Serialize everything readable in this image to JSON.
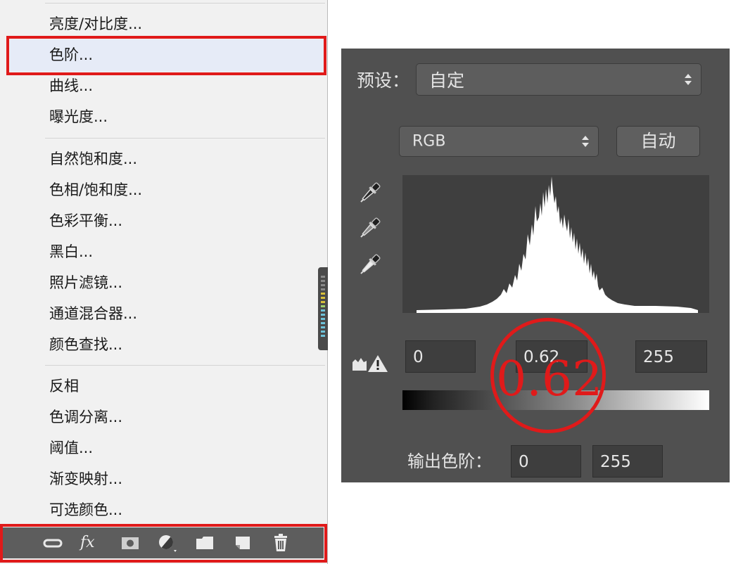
{
  "menu": {
    "items": [
      {
        "label": "亮度/对比度..."
      },
      {
        "label": "色阶..."
      },
      {
        "label": "曲线..."
      },
      {
        "label": "曝光度..."
      },
      {
        "label": "自然饱和度..."
      },
      {
        "label": "色相/饱和度..."
      },
      {
        "label": "色彩平衡..."
      },
      {
        "label": "黑白..."
      },
      {
        "label": "照片滤镜..."
      },
      {
        "label": "通道混合器..."
      },
      {
        "label": "颜色查找..."
      },
      {
        "label": "反相"
      },
      {
        "label": "色调分离..."
      },
      {
        "label": "阈值..."
      },
      {
        "label": "渐变映射..."
      },
      {
        "label": "可选颜色..."
      }
    ],
    "highlighted": "色阶...",
    "toolbar_icons": [
      "link-icon",
      "fx-icon",
      "mask-icon",
      "adjustment-icon",
      "folder-icon",
      "new-layer-icon",
      "trash-icon"
    ],
    "fx_label": "fx"
  },
  "levels": {
    "preset_label": "预设：",
    "preset_value": "自定",
    "channel_value": "RGB",
    "auto_button": "自动",
    "input_black": "0",
    "input_gamma": "0.62",
    "input_white": "255",
    "output_label": "输出色阶：",
    "output_black": "0",
    "output_white": "255"
  },
  "annotation": {
    "text": "0.62",
    "color": "#e01a1a"
  },
  "colors": {
    "panel_bg": "#505050",
    "menu_bg": "#f1f1f1",
    "highlight_red": "#e01a1a"
  }
}
